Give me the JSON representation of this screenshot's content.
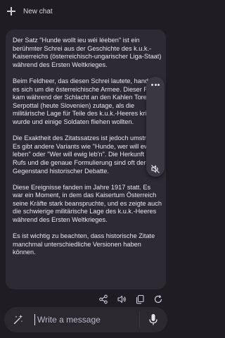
{
  "header": {
    "new_chat_label": "New chat"
  },
  "message": {
    "paragraphs": [
      "Der Satz \"Hunde wollt ieu wéi léeben\" ist ein berühmter Schrei aus der Geschichte des k.u.k.-Kaiserreichs (österreichisch-ungarischer Liga-Staat) während des Ersten Weltkrieges.",
      "Beim Feldheer, das diesen Schrei lautete, handelt es sich um die österreichische Armee. Dieser Ruf kam während der Schlacht an den Kahlen Toren in Serpottal (heute Slovenien) zutage, als die militärische Lage für Teile des k.u.k.-Heeres kritisch wurde und einige Soldaten fliehen wollten.",
      "Die Exaktheit des Zitatssatzes ist jedoch umstritten. Es gibt andere Variants wie \"Hunde, wer will ewig leben\" oder \"Wer will ewig leb'n\". Die Herkunft des Rufs und die genaue Formulierung sind oft der Gegenstand historischer Debatte.",
      "Diese Ereignisse fanden im Jahre 1917 statt. Es war ein Moment, in dem das Kaisertum Österreich seine Kräfte stark beanspruchte, und es zeigte auch die schwierige militärische Lage des k.u.k.-Heeres während des Ersten Weltkrieges.",
      "Es ist wichtig zu beachten, dass historische Zitate manchmal unterschiedliche Versionen haben können."
    ]
  },
  "side_menu": {
    "more_icon": "more-horizontal-icon",
    "speaker_icon": "speaker-off-icon"
  },
  "actions": {
    "icons": [
      "share-icon",
      "speaker-icon",
      "copy-icon",
      "regenerate-icon"
    ]
  },
  "composer": {
    "placeholder": "Write a message",
    "left_icon": "magic-wand-icon",
    "right_icon": "microphone-icon"
  },
  "colors": {
    "background": "#1f1c24",
    "bubble": "#2d2a33",
    "accent": "#e6e3ec"
  }
}
